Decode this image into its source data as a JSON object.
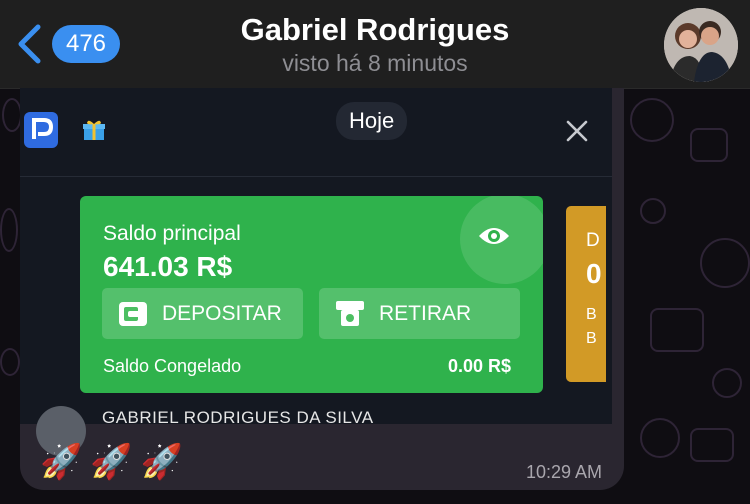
{
  "header": {
    "back_count": "476",
    "title": "Gabriel Rodrigues",
    "subtitle": "visto há 8 minutos"
  },
  "screenshot": {
    "date_chip": "Hoje",
    "main_balance": {
      "label": "Saldo principal",
      "amount": "641.03 R$",
      "deposit_label": "DEPOSITAR",
      "withdraw_label": "RETIRAR",
      "frozen_label": "Saldo Congelado",
      "frozen_value": "0.00 R$"
    },
    "secondary_card": {
      "line1": "D",
      "line2": "0",
      "line3": "B",
      "line4": "B"
    },
    "account_name": "GABRIEL RODRIGUES DA SILVA"
  },
  "message": {
    "text": "🚀🚀🚀",
    "time": "10:29 AM"
  },
  "colors": {
    "accent": "#3a8ff0",
    "green_card": "#2fb24c",
    "gold_card": "#d29a26"
  }
}
